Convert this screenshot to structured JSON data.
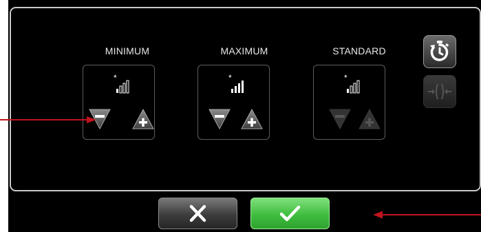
{
  "modes": [
    {
      "key": "minimum",
      "label": "MINIMUM",
      "enabled": true
    },
    {
      "key": "maximum",
      "label": "MAXIMUM",
      "enabled": true
    },
    {
      "key": "standard",
      "label": "STANDARD",
      "enabled": false
    }
  ],
  "icons": {
    "signal": "signal-strength-icon",
    "minus": "minus-icon",
    "plus": "plus-icon",
    "timer": "stopwatch-reset-icon",
    "focus": "focus-compress-icon",
    "cancel": "close-icon",
    "confirm": "checkmark-icon"
  },
  "colors": {
    "confirm_green": "#3fbd3f",
    "annotation_red": "#c0141e",
    "disabled_gray": "#3a3a3a"
  }
}
